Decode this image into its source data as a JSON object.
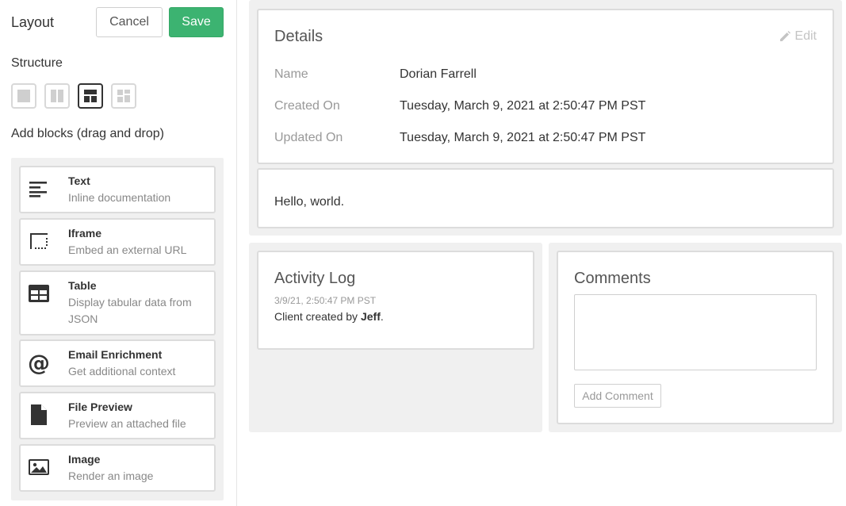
{
  "sidebar": {
    "title": "Layout",
    "cancel_label": "Cancel",
    "save_label": "Save",
    "structure_label": "Structure",
    "structure_options": [
      "single-column",
      "two-column",
      "header-two-column",
      "grid"
    ],
    "structure_active": "header-two-column",
    "add_blocks_label": "Add blocks (drag and drop)",
    "blocks": [
      {
        "title": "Text",
        "desc": "Inline documentation",
        "icon": "text-align-icon"
      },
      {
        "title": "Iframe",
        "desc": "Embed an external URL",
        "icon": "iframe-icon"
      },
      {
        "title": "Table",
        "desc": "Display tabular data from JSON",
        "icon": "table-icon"
      },
      {
        "title": "Email Enrichment",
        "desc": "Get additional context",
        "icon": "at-sign-icon"
      },
      {
        "title": "File Preview",
        "desc": "Preview an attached file",
        "icon": "file-icon"
      },
      {
        "title": "Image",
        "desc": "Render an image",
        "icon": "image-icon"
      }
    ]
  },
  "details": {
    "title": "Details",
    "edit_label": "Edit",
    "fields": [
      {
        "label": "Name",
        "value": "Dorian Farrell"
      },
      {
        "label": "Created On",
        "value": "Tuesday, March 9, 2021 at 2:50:47 PM PST"
      },
      {
        "label": "Updated On",
        "value": "Tuesday, March 9, 2021 at 2:50:47 PM PST"
      }
    ]
  },
  "hello": {
    "text": "Hello, world."
  },
  "activity": {
    "title": "Activity Log",
    "time": "3/9/21, 2:50:47 PM PST",
    "text_prefix": "Client created by ",
    "text_user": "Jeff",
    "text_suffix": "."
  },
  "comments": {
    "title": "Comments",
    "input_value": "",
    "button_label": "Add Comment"
  },
  "colors": {
    "save_green": "#3cb371",
    "panel_grey": "#f0f0f0",
    "border_grey": "#dcdcdc"
  }
}
